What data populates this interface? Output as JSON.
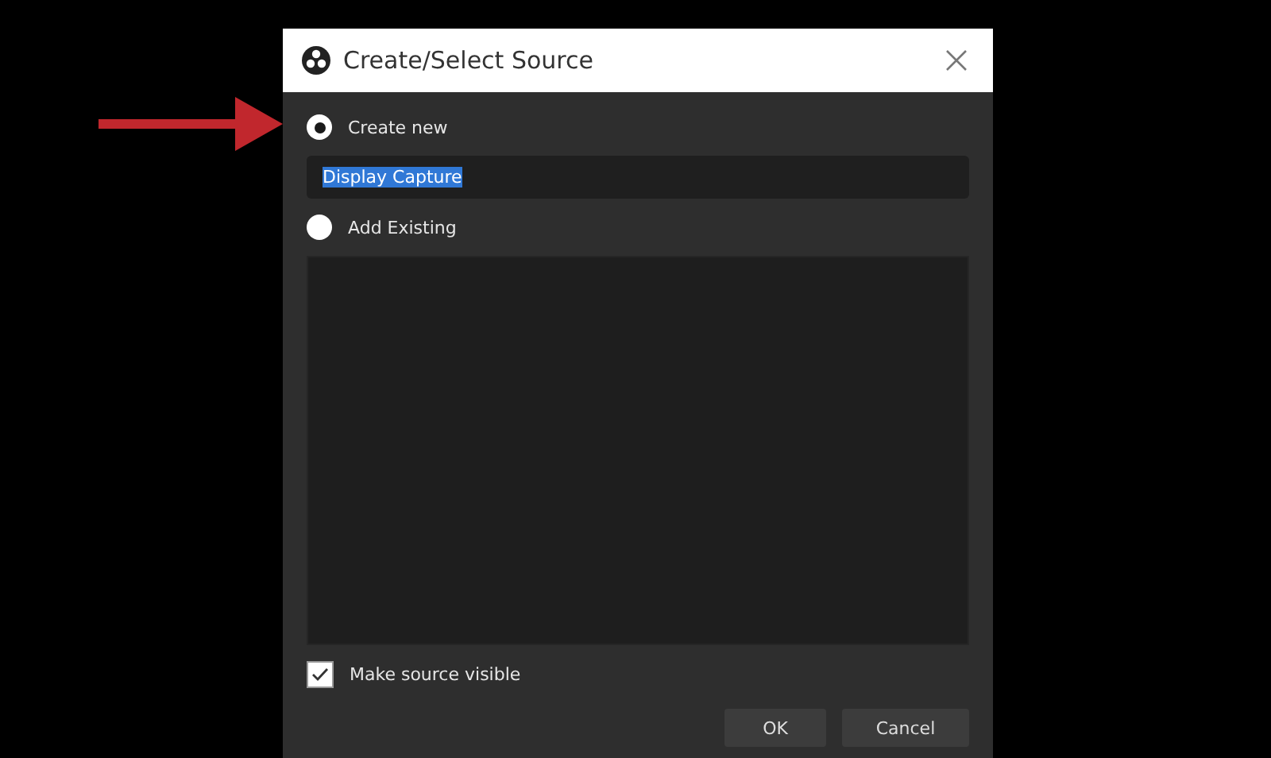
{
  "window": {
    "title": "Create/Select Source"
  },
  "options": [
    {
      "label": "Create new",
      "selected": true
    },
    {
      "label": "Add Existing",
      "selected": false
    }
  ],
  "name_field": {
    "value": "Display Capture",
    "text_selected": true
  },
  "make_visible": {
    "label": "Make source visible",
    "checked": true
  },
  "buttons": [
    "OK",
    "Cancel"
  ]
}
